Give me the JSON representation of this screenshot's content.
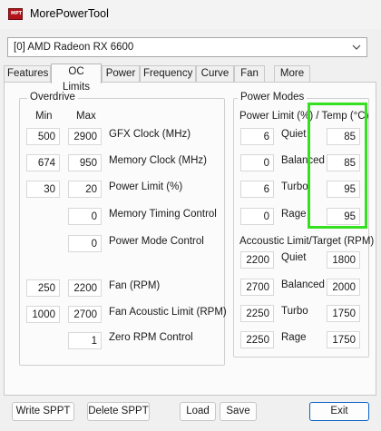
{
  "window": {
    "title": "MorePowerTool",
    "icon_text": "MPT"
  },
  "gpu_select": {
    "value": "[0] AMD Radeon RX 6600"
  },
  "tabs": [
    {
      "label": "Features"
    },
    {
      "label": "OC Limits"
    },
    {
      "label": "Power"
    },
    {
      "label": "Frequency"
    },
    {
      "label": "Curve"
    },
    {
      "label": "Fan"
    },
    {
      "label": "More"
    }
  ],
  "overdrive": {
    "title": "Overdrive",
    "min_header": "Min",
    "max_header": "Max",
    "rows": [
      {
        "label": "GFX Clock (MHz)",
        "min": "500",
        "max": "2900"
      },
      {
        "label": "Memory Clock (MHz)",
        "min": "674",
        "max": "950"
      },
      {
        "label": "Power Limit (%)",
        "min": "30",
        "max": "20"
      },
      {
        "label": "Memory Timing Control",
        "max": "0"
      },
      {
        "label": "Power Mode Control",
        "max": "0"
      },
      {
        "label": "Fan (RPM)",
        "min": "250",
        "max": "2200"
      },
      {
        "label": "Fan Acoustic Limit (RPM)",
        "min": "1000",
        "max": "2700"
      },
      {
        "label": "Zero RPM Control",
        "max": "1"
      }
    ]
  },
  "power_modes": {
    "title": "Power Modes",
    "header": "Power Limit (%) / Temp (°C)",
    "rows": [
      {
        "label": "Quiet",
        "power": "6",
        "temp": "85"
      },
      {
        "label": "Balanced",
        "power": "0",
        "temp": "85"
      },
      {
        "label": "Turbo",
        "power": "6",
        "temp": "95"
      },
      {
        "label": "Rage",
        "power": "0",
        "temp": "95"
      }
    ],
    "acoustic_header": "Accoustic Limit/Target (RPM)",
    "acoustic_rows": [
      {
        "label": "Quiet",
        "limit": "2200",
        "target": "1800"
      },
      {
        "label": "Balanced",
        "limit": "2700",
        "target": "2000"
      },
      {
        "label": "Turbo",
        "limit": "2250",
        "target": "1750"
      },
      {
        "label": "Rage",
        "limit": "2250",
        "target": "1750"
      }
    ]
  },
  "buttons": {
    "write": "Write SPPT",
    "delete": "Delete SPPT",
    "load": "Load",
    "save": "Save",
    "exit": "Exit"
  },
  "colors": {
    "highlight": "#35e020",
    "exit_border": "#0a62c4",
    "icon": "#b3141b"
  }
}
